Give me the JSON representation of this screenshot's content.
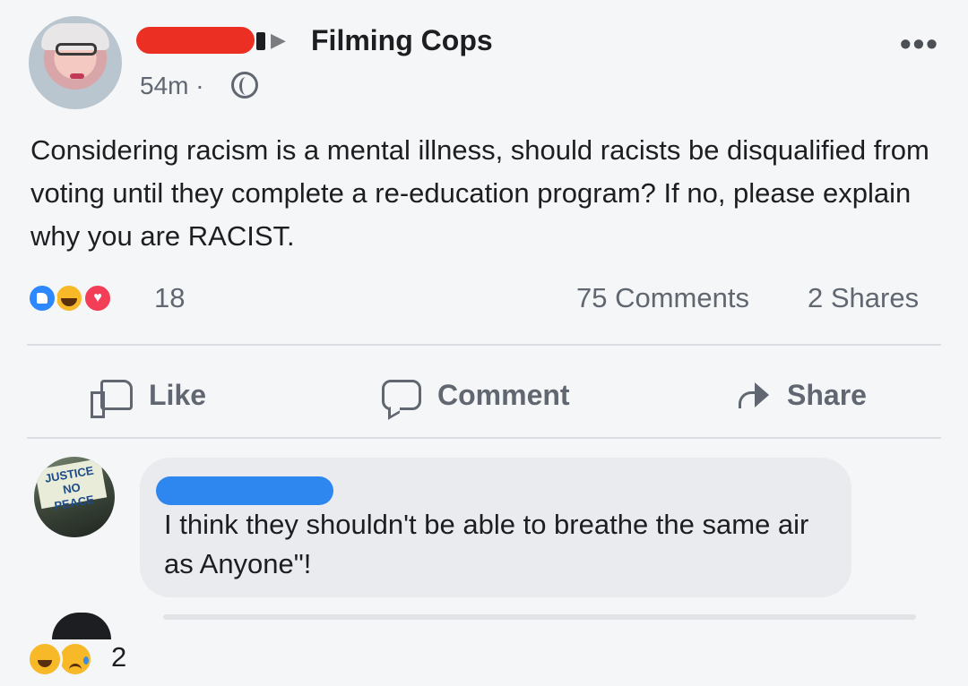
{
  "post": {
    "group_name": "Filming Cops",
    "timestamp": "54m ·",
    "more_label": "•••",
    "text": "Considering racism is a mental illness, should racists be disqualified from voting until they complete a re-education program? If no, please explain why you are RACIST."
  },
  "stats": {
    "reactions_count": "18",
    "comments": "75 Comments",
    "shares": "2 Shares"
  },
  "actions": {
    "like": "Like",
    "comment": "Comment",
    "share": "Share"
  },
  "comment": {
    "avatar_sign_text": "JUSTICE NO PEACE",
    "text": "I think they shouldn't be able to breathe the same air as Anyone\"!",
    "reactions_count": "2"
  },
  "icons": {
    "reactions": [
      "like-icon",
      "haha-icon",
      "love-icon"
    ],
    "comment_reactions": [
      "haha-icon",
      "sad-icon"
    ],
    "privacy": "globe-icon",
    "arrow": "right-arrow-icon"
  },
  "colors": {
    "name_redaction": "#ec2f23",
    "commenter_redaction": "#2e86ef",
    "like_blue": "#2d88ff",
    "haha_yellow": "#f7b928",
    "love_red": "#f33e58"
  }
}
